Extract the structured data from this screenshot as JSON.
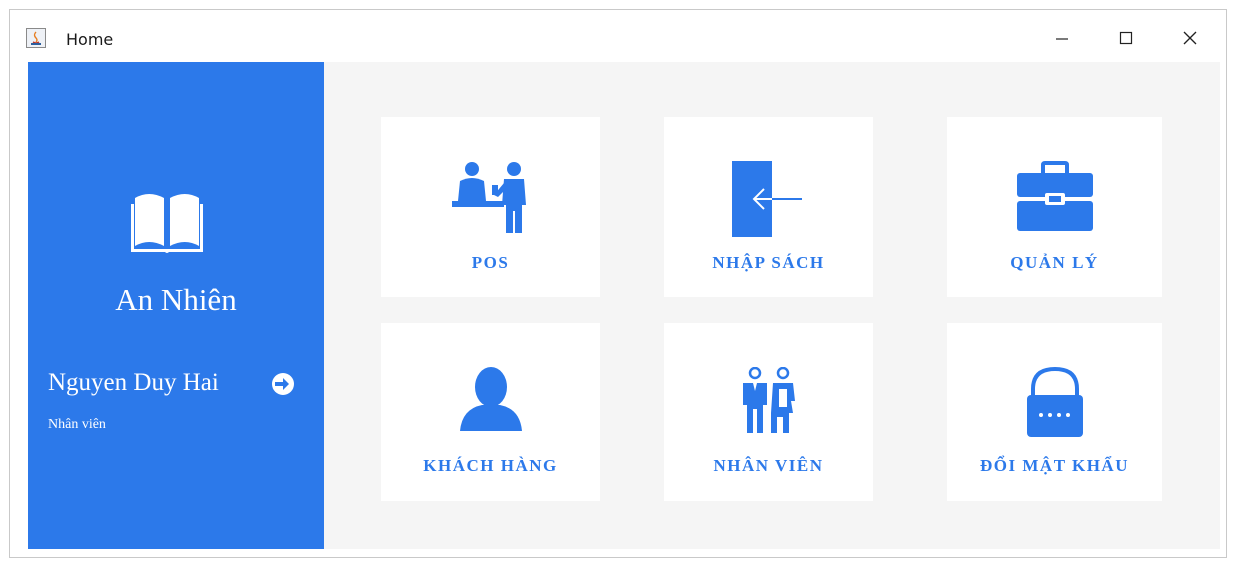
{
  "window": {
    "title": "Home",
    "buttons": [
      "minimize",
      "maximize",
      "close"
    ]
  },
  "sidebar": {
    "brand": "An Nhiên",
    "user_name": "Nguyen Duy Hai",
    "user_role": "Nhân viên",
    "icons": [
      "open-book-icon",
      "logout-icon"
    ],
    "bg_color": "#2c79ea"
  },
  "tiles": [
    {
      "label": "POS",
      "icon": "cashier-people-icon"
    },
    {
      "label": "NHẬP SÁCH",
      "icon": "door-enter-icon"
    },
    {
      "label": "QUẢN LÝ",
      "icon": "briefcase-icon"
    },
    {
      "label": "KHÁCH HÀNG",
      "icon": "user-silhouette-icon"
    },
    {
      "label": "NHÂN VIÊN",
      "icon": "staff-couple-icon"
    },
    {
      "label": "ĐỔI MẬT KHẨU",
      "icon": "padlock-icon"
    }
  ],
  "colors": {
    "accent": "#2c79ea",
    "content_bg": "#f5f5f5",
    "tile_bg": "#ffffff"
  }
}
